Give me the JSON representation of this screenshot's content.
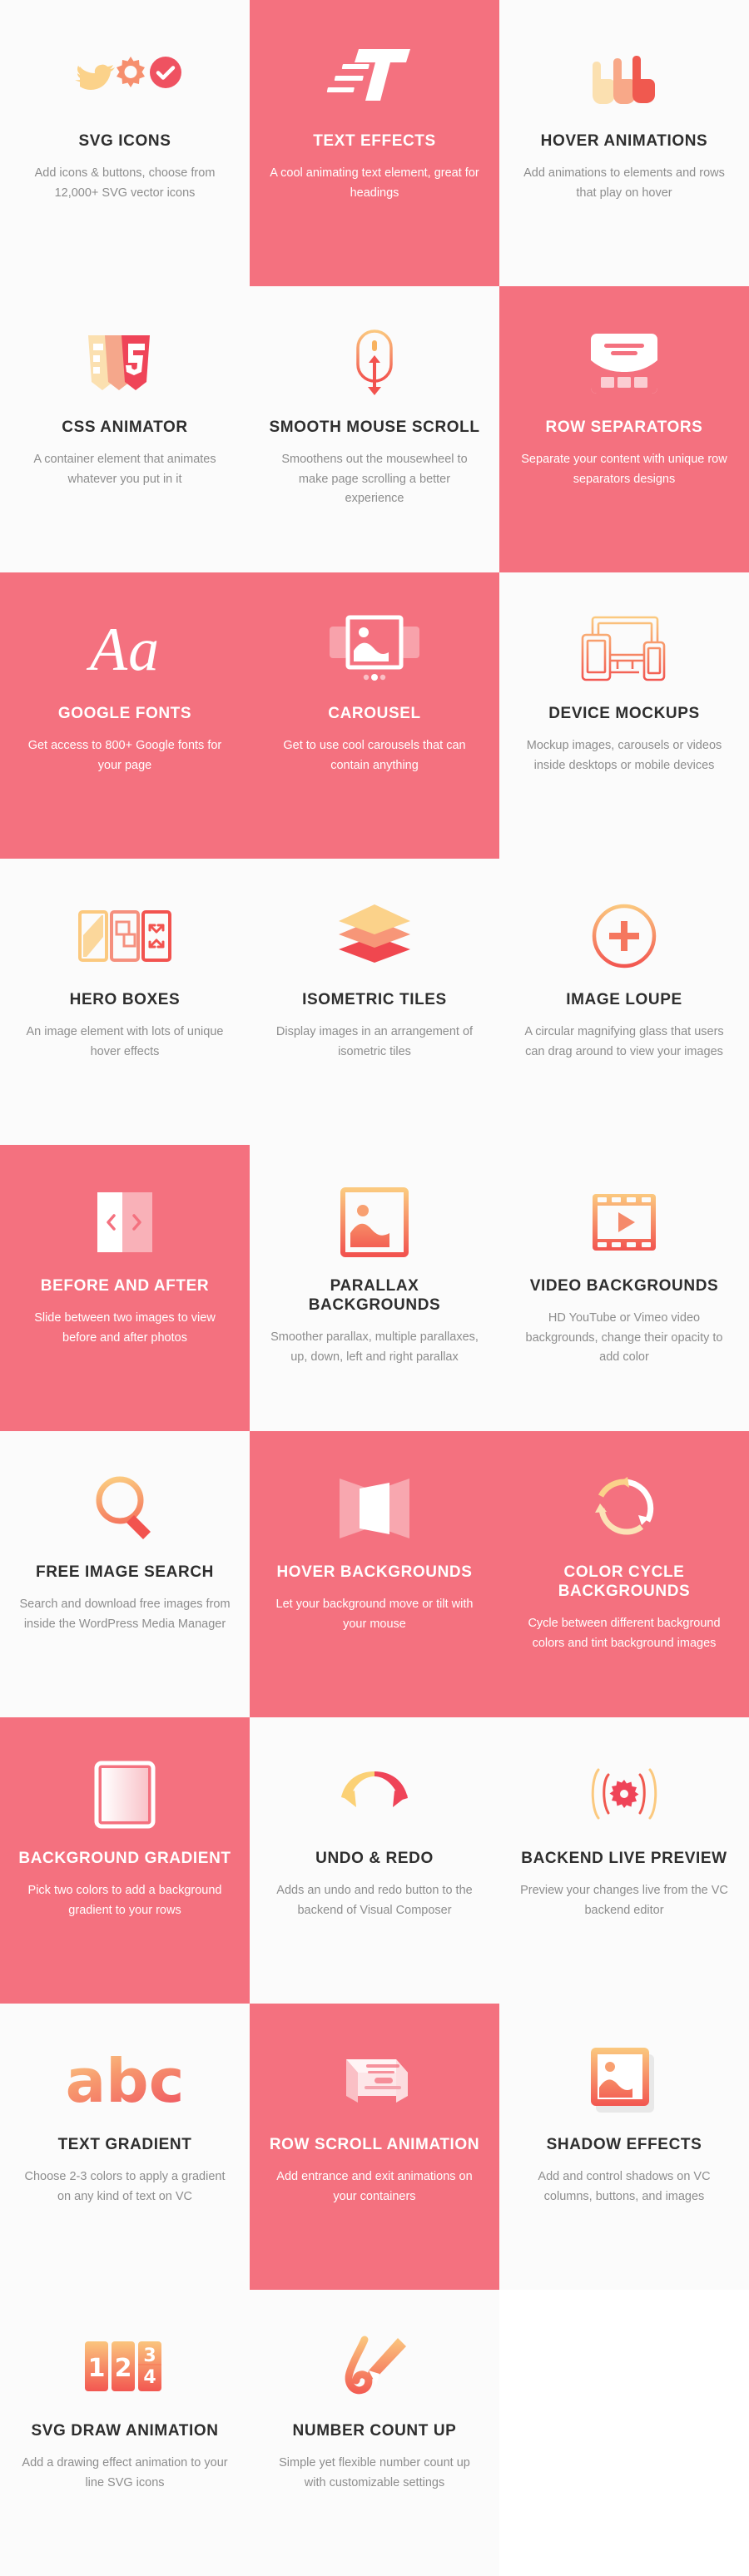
{
  "theme": {
    "accent_pink": "#f4717f",
    "card_bg": "#fbfbfb",
    "title_color": "#2e2e2e",
    "desc_color": "#8d8d8d",
    "gradient_yellow": "#fbd28a",
    "gradient_orange": "#f79a6e",
    "gradient_red": "#ef5261"
  },
  "features": [
    {
      "icon": "svg-icons-icon",
      "title": "SVG ICONS",
      "desc": "Add icons & buttons, choose from 12,000+ SVG vector icons",
      "style": "light"
    },
    {
      "icon": "text-effects-icon",
      "title": "TEXT EFFECTS",
      "desc": "A cool animating text element, great for headings",
      "style": "pink"
    },
    {
      "icon": "hover-animations-icon",
      "title": "HOVER ANIMATIONS",
      "desc": "Add animations to elements and rows that play on hover",
      "style": "light"
    },
    {
      "icon": "css-animator-icon",
      "title": "CSS ANIMATOR",
      "desc": "A container element that animates whatever you put in it",
      "style": "light"
    },
    {
      "icon": "smooth-mouse-scroll-icon",
      "title": "SMOOTH MOUSE SCROLL",
      "desc": "Smoothens out the mousewheel to make page scrolling a better experience",
      "style": "light"
    },
    {
      "icon": "row-separators-icon",
      "title": "ROW SEPARATORS",
      "desc": "Separate your content with unique row separators designs",
      "style": "pink"
    },
    {
      "icon": "google-fonts-icon",
      "title": "GOOGLE FONTS",
      "desc": "Get access to 800+ Google fonts for your page",
      "style": "pink"
    },
    {
      "icon": "carousel-icon",
      "title": "CAROUSEL",
      "desc": "Get to use cool carousels that can contain anything",
      "style": "pink"
    },
    {
      "icon": "device-mockups-icon",
      "title": "DEVICE MOCKUPS",
      "desc": "Mockup images, carousels or videos inside desktops or mobile devices",
      "style": "light"
    },
    {
      "icon": "hero-boxes-icon",
      "title": "HERO BOXES",
      "desc": "An image element with lots of unique hover effects",
      "style": "light"
    },
    {
      "icon": "isometric-tiles-icon",
      "title": "ISOMETRIC TILES",
      "desc": "Display images in an arrangement of isometric tiles",
      "style": "light"
    },
    {
      "icon": "image-loupe-icon",
      "title": "IMAGE LOUPE",
      "desc": "A circular magnifying glass that users can drag around to view your images",
      "style": "light"
    },
    {
      "icon": "before-and-after-icon",
      "title": "BEFORE AND AFTER",
      "desc": "Slide between two images to view before and after photos",
      "style": "pink"
    },
    {
      "icon": "parallax-backgrounds-icon",
      "title": "PARALLAX BACKGROUNDS",
      "desc": "Smoother parallax, multiple parallaxes, up, down, left and right parallax",
      "style": "light"
    },
    {
      "icon": "video-backgrounds-icon",
      "title": "VIDEO BACKGROUNDS",
      "desc": "HD YouTube or Vimeo video backgrounds, change their opacity to add color",
      "style": "light"
    },
    {
      "icon": "free-image-search-icon",
      "title": "FREE IMAGE SEARCH",
      "desc": "Search and download free images from inside the WordPress Media Manager",
      "style": "light"
    },
    {
      "icon": "hover-backgrounds-icon",
      "title": "HOVER BACKGROUNDS",
      "desc": "Let your background move or tilt with your mouse",
      "style": "pink"
    },
    {
      "icon": "color-cycle-backgrounds-icon",
      "title": "COLOR CYCLE BACKGROUNDS",
      "desc": "Cycle between different background colors and tint background images",
      "style": "pink"
    },
    {
      "icon": "background-gradient-icon",
      "title": "BACKGROUND GRADIENT",
      "desc": "Pick two colors to add a background gradient to your rows",
      "style": "pink"
    },
    {
      "icon": "undo-redo-icon",
      "title": "UNDO & REDO",
      "desc": "Adds an undo and redo button to the backend of Visual Composer",
      "style": "light"
    },
    {
      "icon": "backend-live-preview-icon",
      "title": "BACKEND LIVE PREVIEW",
      "desc": "Preview your changes live from the VC backend editor",
      "style": "light"
    },
    {
      "icon": "text-gradient-icon",
      "title": "TEXT GRADIENT",
      "desc": "Choose 2-3 colors to apply a gradient on any kind of text on VC",
      "style": "light"
    },
    {
      "icon": "row-scroll-animation-icon",
      "title": "ROW SCROLL ANIMATION",
      "desc": "Add entrance and exit animations on your containers",
      "style": "pink"
    },
    {
      "icon": "shadow-effects-icon",
      "title": "SHADOW EFFECTS",
      "desc": "Add and control shadows on VC columns, buttons, and images",
      "style": "light"
    },
    {
      "icon": "svg-draw-animation-icon",
      "title": "SVG DRAW ANIMATION",
      "desc": "Add a drawing effect animation to your line SVG icons",
      "style": "light"
    },
    {
      "icon": "number-count-up-icon",
      "title": "NUMBER COUNT UP",
      "desc": "Simple yet flexible number count up with customizable settings",
      "style": "light"
    }
  ]
}
